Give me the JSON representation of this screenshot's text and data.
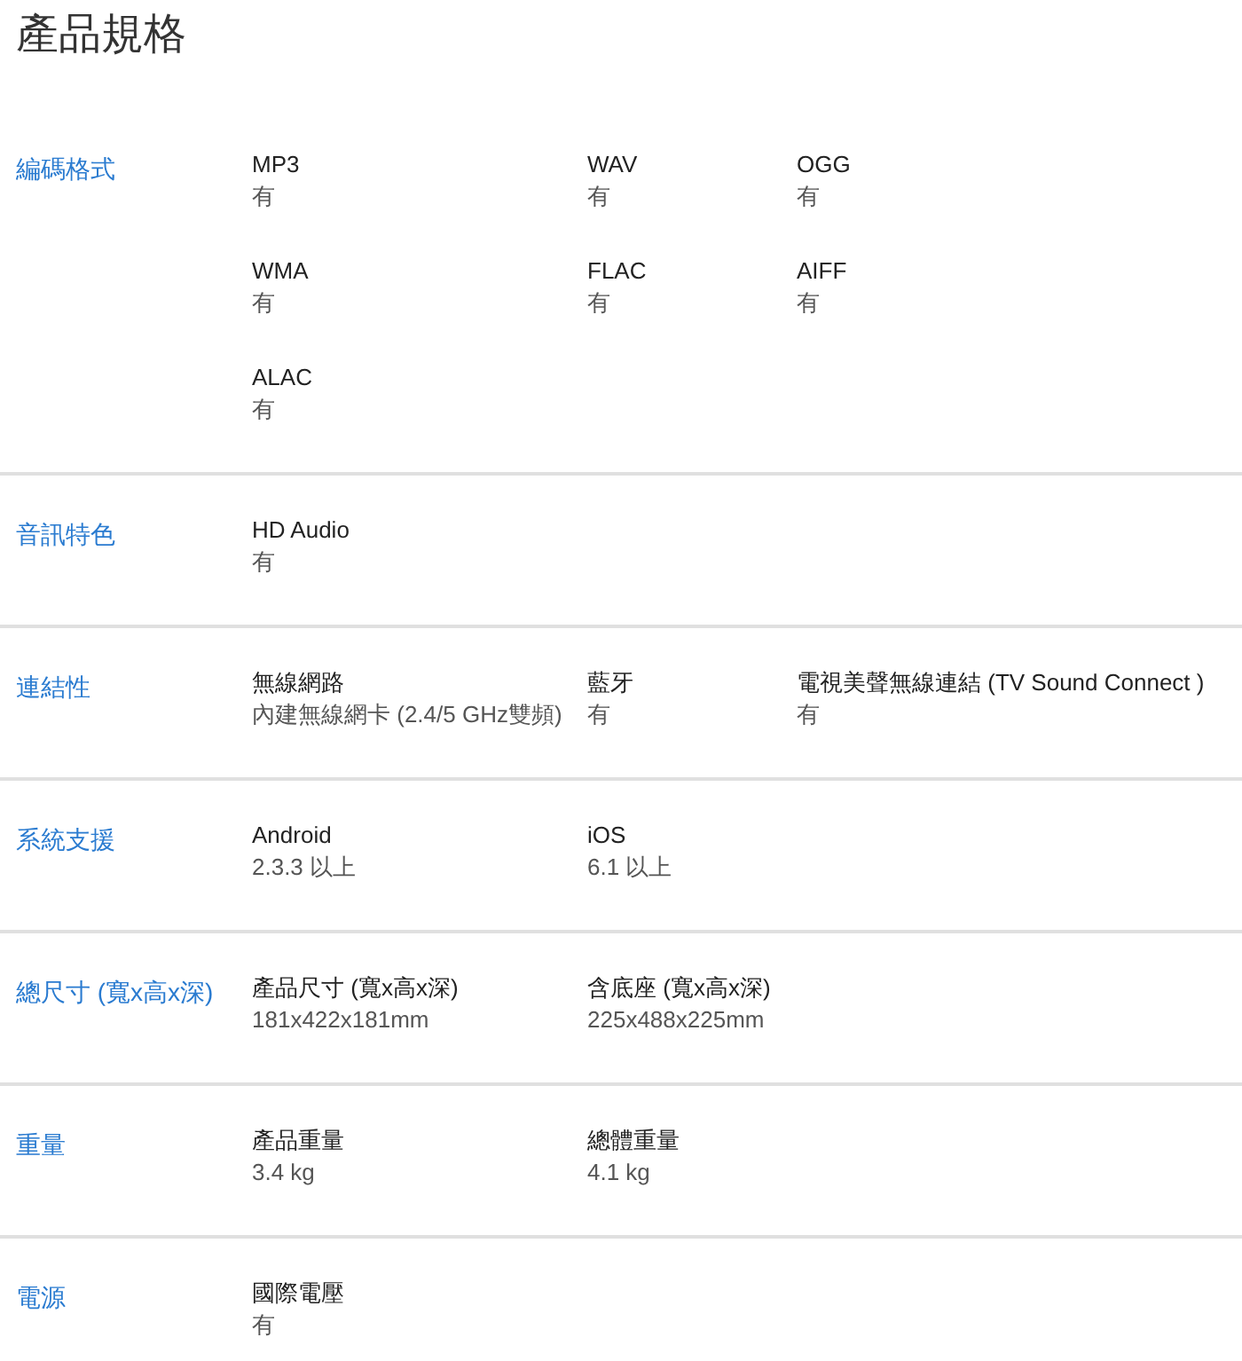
{
  "title": "產品規格",
  "sections": [
    {
      "label": "編碼格式",
      "items": [
        {
          "name": "MP3",
          "value": "有"
        },
        {
          "name": "WAV",
          "value": "有"
        },
        {
          "name": "OGG",
          "value": "有"
        },
        {
          "name": "WMA",
          "value": "有"
        },
        {
          "name": "FLAC",
          "value": "有"
        },
        {
          "name": "AIFF",
          "value": "有"
        },
        {
          "name": "ALAC",
          "value": "有"
        }
      ]
    },
    {
      "label": "音訊特色",
      "items": [
        {
          "name": "HD Audio",
          "value": "有"
        }
      ]
    },
    {
      "label": "連結性",
      "items": [
        {
          "name": "無線網路",
          "value": "內建無線網卡 (2.4/5 GHz雙頻)"
        },
        {
          "name": "藍牙",
          "value": "有"
        },
        {
          "name": "電視美聲無線連結 (TV Sound Connect )",
          "value": "有"
        }
      ]
    },
    {
      "label": "系統支援",
      "items": [
        {
          "name": "Android",
          "value": "2.3.3 以上"
        },
        {
          "name": "iOS",
          "value": "6.1 以上"
        }
      ]
    },
    {
      "label": "總尺寸 (寬x高x深)",
      "items": [
        {
          "name": "產品尺寸 (寬x高x深)",
          "value": "181x422x181mm"
        },
        {
          "name": "含底座 (寬x高x深)",
          "value": "225x488x225mm"
        }
      ]
    },
    {
      "label": "重量",
      "items": [
        {
          "name": "產品重量",
          "value": "3.4 kg"
        },
        {
          "name": "總體重量",
          "value": "4.1 kg"
        }
      ]
    },
    {
      "label": "電源",
      "items": [
        {
          "name": "國際電壓",
          "value": "有"
        }
      ]
    }
  ]
}
